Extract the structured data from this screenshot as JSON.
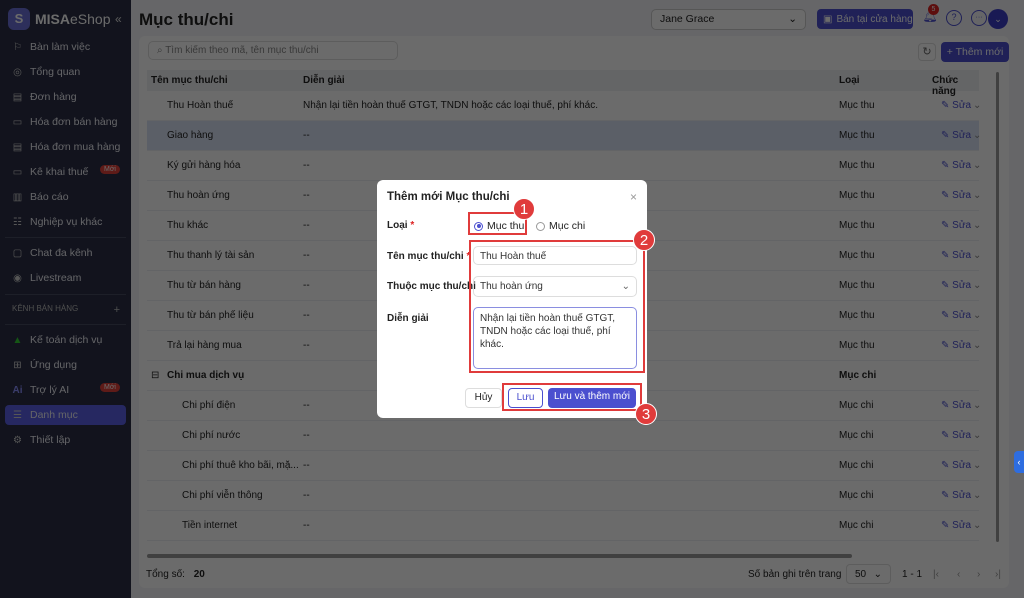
{
  "sidebar": {
    "brand": "MISA",
    "brand_suffix": "eShop",
    "collapse": "«",
    "badge": "Mới",
    "section_label": "KÊNH BÁN HÀNG",
    "section_add": "+",
    "items": [
      {
        "label": "Bàn làm việc",
        "icon": "⚐",
        "name": "desk"
      },
      {
        "label": "Tổng quan",
        "icon": "◎",
        "name": "overview"
      },
      {
        "label": "Đơn hàng",
        "icon": "▤",
        "name": "orders"
      },
      {
        "label": "Hóa đơn bán hàng",
        "icon": "▭",
        "name": "sales-invoice"
      },
      {
        "label": "Hóa đơn mua hàng",
        "icon": "▤",
        "name": "purchase-invoice"
      },
      {
        "label": "Kê khai thuế",
        "icon": "▭",
        "name": "tax",
        "badge": true
      },
      {
        "label": "Báo cáo",
        "icon": "▥",
        "name": "reports"
      },
      {
        "label": "Nghiệp vụ khác",
        "icon": "☷",
        "name": "other-ops"
      },
      {
        "label": "Chat đa kênh",
        "icon": "▢",
        "name": "chat"
      },
      {
        "label": "Livestream",
        "icon": "◉",
        "name": "livestream"
      },
      {
        "label": "Kế toán dịch vụ",
        "icon": "▲",
        "name": "accounting"
      },
      {
        "label": "Ứng dụng",
        "icon": "⊞",
        "name": "apps"
      },
      {
        "label": "Trợ lý AI",
        "icon": "Ai",
        "name": "ai-assistant",
        "badge": true
      },
      {
        "label": "Danh mục",
        "icon": "☰",
        "name": "catalog",
        "active": true
      },
      {
        "label": "Thiết lập",
        "icon": "⚙",
        "name": "settings"
      }
    ]
  },
  "header": {
    "title": "Mục thu/chi",
    "user": "Jane Grace",
    "store_button": "Bán tại cửa hàng",
    "notifications": "5",
    "help": "?",
    "more": "···",
    "avatar": "⌄"
  },
  "toolbar": {
    "search_placeholder": "Tìm kiếm theo mã, tên mục thu/chi",
    "refresh": "↻",
    "add": "+ Thêm mới"
  },
  "table": {
    "columns": [
      "Tên mục thu/chi",
      "Diễn giải",
      "Loại",
      "Chức năng"
    ],
    "edit": "✎ Sửa",
    "more": "⌄",
    "rows": [
      {
        "name": "Thu Hoàn thuế",
        "desc": "Nhận lại tiền hoàn thuế GTGT, TNDN hoặc các loại thuế, phí khác.",
        "type": "Mục thu",
        "level": 1
      },
      {
        "name": "Giao hàng",
        "desc": "--",
        "type": "Mục thu",
        "level": 1,
        "highlight": true
      },
      {
        "name": "Ký gửi hàng hóa",
        "desc": "--",
        "type": "Mục thu",
        "level": 1
      },
      {
        "name": "Thu hoàn ứng",
        "desc": "--",
        "type": "Mục thu",
        "level": 1
      },
      {
        "name": "Thu khác",
        "desc": "--",
        "type": "Mục thu",
        "level": 1
      },
      {
        "name": "Thu thanh lý tài sản",
        "desc": "--",
        "type": "Mục thu",
        "level": 1
      },
      {
        "name": "Thu từ bán hàng",
        "desc": "--",
        "type": "Mục thu",
        "level": 1
      },
      {
        "name": "Thu từ bán phế liệu",
        "desc": "--",
        "type": "Mục thu",
        "level": 1
      },
      {
        "name": "Trả lại hàng mua",
        "desc": "--",
        "type": "Mục thu",
        "level": 1
      },
      {
        "name": "Chi mua dịch vụ",
        "desc": "",
        "type": "Mục chi",
        "level": 0,
        "group": true,
        "toggle": "⊟"
      },
      {
        "name": "Chi phí điện",
        "desc": "--",
        "type": "Mục chi",
        "level": 2
      },
      {
        "name": "Chi phí nước",
        "desc": "--",
        "type": "Mục chi",
        "level": 2
      },
      {
        "name": "Chi phí thuê kho bãi, mặ...",
        "desc": "--",
        "type": "Mục chi",
        "level": 2
      },
      {
        "name": "Chi phí viễn thông",
        "desc": "--",
        "type": "Mục chi",
        "level": 2
      },
      {
        "name": "Tiền internet",
        "desc": "--",
        "type": "Mục chi",
        "level": 2
      }
    ]
  },
  "footer": {
    "total_label": "Tổng số:",
    "total": "20",
    "per_page_label": "Số bản ghi trên trang",
    "per_page": "50",
    "range": "1 - 1",
    "first": "|‹",
    "prev": "‹",
    "next": "›",
    "last": "›|"
  },
  "side_tab": "‹",
  "dialog": {
    "title": "Thêm mới Mục thu/chi",
    "close": "×",
    "type_label": "Loại",
    "required": "*",
    "option_income": "Mục thu",
    "option_expense": "Mục chi",
    "name_label": "Tên mục thu/chi",
    "name_value": "Thu Hoàn thuế",
    "parent_label": "Thuộc mục thu/chi",
    "parent_value": "Thu hoàn ứng",
    "desc_label": "Diễn giải",
    "desc_value": "Nhận lại tiền hoàn thuế GTGT, TNDN hoặc các loại thuế, phí khác.",
    "cancel": "Hủy",
    "save": "Lưu",
    "save_new": "Lưu và thêm mới"
  },
  "annotations": [
    "1",
    "2",
    "3"
  ]
}
